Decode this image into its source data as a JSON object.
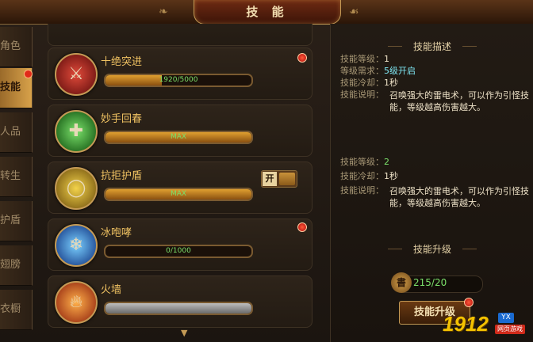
{
  "title": "技 能",
  "tabs": [
    {
      "label": "角色",
      "active": false
    },
    {
      "label": "技能",
      "active": true
    },
    {
      "label": "人品",
      "active": false
    },
    {
      "label": "转生",
      "active": false
    },
    {
      "label": "护盾",
      "active": false
    },
    {
      "label": "翅膀",
      "active": false
    },
    {
      "label": "衣橱",
      "active": false
    }
  ],
  "skills": [
    {
      "name": "十绝突进",
      "progress_text": "1920/5000",
      "progress": 0.384,
      "icon": "slash-skill-icon",
      "color": "#c0302a",
      "red_dot": true
    },
    {
      "name": "妙手回春",
      "progress_text": "MAX",
      "progress": 1.0,
      "icon": "heal-skill-icon",
      "color": "#3fa83a",
      "red_dot": false
    },
    {
      "name": "抗拒护盾",
      "progress_text": "MAX",
      "progress": 1.0,
      "icon": "shield-skill-icon",
      "color": "#d8a020",
      "red_dot": false,
      "toggle": "开"
    },
    {
      "name": "冰咆哮",
      "progress_text": "0/1000",
      "progress": 0.0,
      "icon": "ice-skill-icon",
      "color": "#2a7ad8",
      "red_dot": true
    },
    {
      "name": "火墙",
      "progress_text": "",
      "progress": 1.0,
      "icon": "fire-skill-icon",
      "color": "#e0601a",
      "red_dot": false
    }
  ],
  "description": {
    "heading": "技能描述",
    "current": {
      "level_label": "技能等级：",
      "level": "1",
      "req_label": "等级需求：",
      "req": "5级开启",
      "cd_label": "技能冷却：",
      "cd": "1秒",
      "desc_label": "技能说明：",
      "desc": "召唤强大的雷电术，可以作为引怪技能，等级越高伤害越大。"
    },
    "next": {
      "level_label": "技能等级：",
      "level": "2",
      "cd_label": "技能冷却：",
      "cd": "1秒",
      "desc_label": "技能说明：",
      "desc": "召唤强大的雷电术，可以作为引怪技能，等级越高伤害越大。"
    }
  },
  "upgrade": {
    "heading": "技能升级",
    "cost": "215/20",
    "button": "技能升级"
  },
  "watermark": {
    "num": "1912",
    "yx": "YX",
    "sub": "网页游戏"
  }
}
